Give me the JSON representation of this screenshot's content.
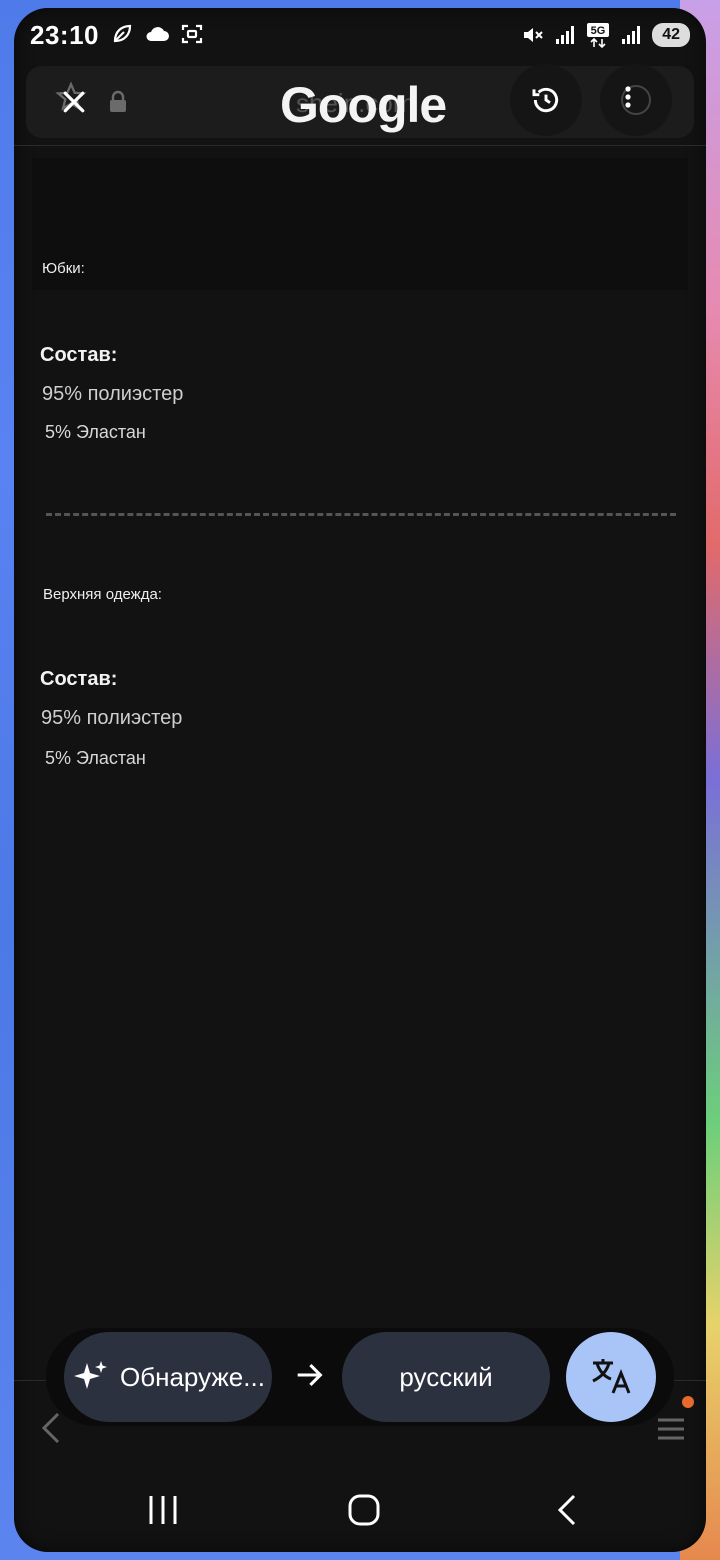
{
  "status_bar": {
    "time": "23:10",
    "battery": "42",
    "network": "5G"
  },
  "browser": {
    "url_faded": "shein.com",
    "logo": "Google"
  },
  "content": {
    "section1_label": "Юбки:",
    "section1_heading": "Состав:",
    "section1_line1": "95% полиэстер",
    "section1_line2": "5% Эластан",
    "section2_label": "Верхняя одежда:",
    "section2_heading": "Состав:",
    "section2_line1": "95% полиэстер",
    "section2_line2": "5% Эластан"
  },
  "translate": {
    "source_language": "Обнаруже...",
    "target_language": "русский"
  },
  "colors": {
    "background": "#121212",
    "pill": "#2c3140",
    "translate_accent": "#a9c4f7",
    "notification_dot": "#e56a2c"
  }
}
